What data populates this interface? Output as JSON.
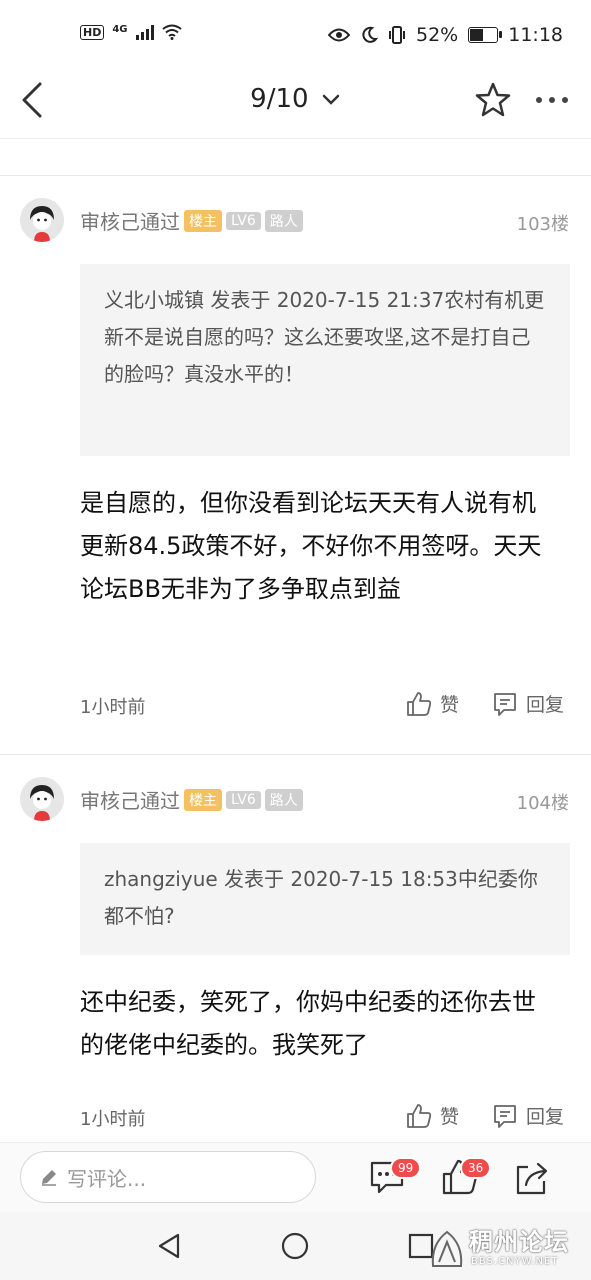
{
  "status_bar": {
    "hd": "HD",
    "network": "4G",
    "battery_pct": "52%",
    "time": "11:18",
    "battery_level": 0.52
  },
  "nav": {
    "page_indicator": "9/10",
    "icons": [
      "back-arrow-icon",
      "chevron-down-icon",
      "star-icon",
      "more-icon"
    ]
  },
  "posts": [
    {
      "username": "审核己通过",
      "badge_owner": "楼主",
      "badge_level": "LV6",
      "badge_title": "路人",
      "floor": "103楼",
      "quote": "义北小城镇 发表于 2020-7-15 21:37农村有机更新不是说自愿的吗？这么还要攻坚,这不是打自己的脸吗？真没水平的！",
      "content": "是自愿的，但你没看到论坛天天有人说有机更新84.5政策不好，不好你不用签呀。天天论坛BB无非为了多争取点到益",
      "time": "1小时前",
      "like_label": "赞",
      "reply_label": "回复"
    },
    {
      "username": "审核己通过",
      "badge_owner": "楼主",
      "badge_level": "LV6",
      "badge_title": "路人",
      "floor": "104楼",
      "quote": "zhangziyue 发表于 2020-7-15 18:53中纪委你都不怕?",
      "content": "还中纪委，笑死了，你妈中纪委的还你去世的佬佬中纪委的。我笑死了",
      "time": "1小时前",
      "like_label": "赞",
      "reply_label": "回复"
    }
  ],
  "comment_bar": {
    "placeholder": "写评论...",
    "comments_count": "99",
    "likes_count": "36"
  },
  "watermark": {
    "title": "稠州论坛",
    "url": "BBS.CNYW.NET"
  },
  "colors": {
    "owner_badge": "#f5c062",
    "gray_badge": "#cfcfcf",
    "count_badge": "#ef4b4b",
    "quote_bg": "#f4f4f4"
  }
}
